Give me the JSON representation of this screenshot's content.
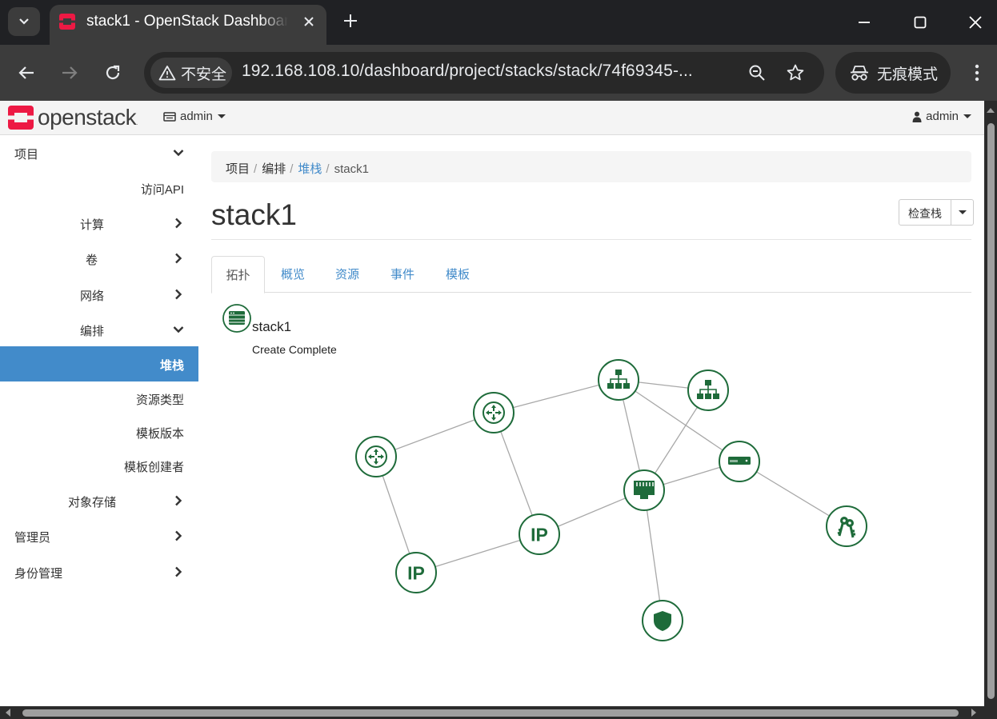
{
  "browser": {
    "tab_title": "stack1 - OpenStack Dashboard",
    "security_label": "不安全",
    "url": "192.168.108.10/dashboard/project/stacks/stack/74f69345-...",
    "incognito_label": "无痕模式"
  },
  "topnav": {
    "logo_text": "openstack",
    "logo_reg": ".",
    "project": "admin",
    "user": "admin"
  },
  "sidebar": {
    "items": [
      {
        "label": "项目",
        "chevron": "down"
      },
      {
        "label": "访问API",
        "chevron": ""
      },
      {
        "label": "计算",
        "chevron": "right"
      },
      {
        "label": "卷",
        "chevron": "right"
      },
      {
        "label": "网络",
        "chevron": "right"
      },
      {
        "label": "编排",
        "chevron": "down"
      },
      {
        "label": "堆栈",
        "chevron": "",
        "active": true
      },
      {
        "label": "资源类型",
        "chevron": ""
      },
      {
        "label": "模板版本",
        "chevron": ""
      },
      {
        "label": "模板创建者",
        "chevron": ""
      },
      {
        "label": "对象存储",
        "chevron": "right"
      },
      {
        "label": "管理员",
        "chevron": "right"
      },
      {
        "label": "身份管理",
        "chevron": "right"
      }
    ]
  },
  "breadcrumb": {
    "items": [
      "项目",
      "编排",
      "堆栈",
      "stack1"
    ]
  },
  "page": {
    "title": "stack1",
    "check_button": "检查栈"
  },
  "tabs": [
    {
      "label": "拓扑",
      "active": true
    },
    {
      "label": "概览",
      "active": false
    },
    {
      "label": "资源",
      "active": false
    },
    {
      "label": "事件",
      "active": false
    },
    {
      "label": "模板",
      "active": false
    }
  ],
  "stack_info": {
    "name": "stack1",
    "status": "Create Complete"
  },
  "topology": {
    "color": "#1e6b3a",
    "nodes": [
      {
        "id": "router1",
        "icon": "router-icon"
      },
      {
        "id": "router2",
        "icon": "router-icon"
      },
      {
        "id": "net1",
        "icon": "network-icon"
      },
      {
        "id": "net2",
        "icon": "network-icon"
      },
      {
        "id": "port",
        "icon": "port-icon"
      },
      {
        "id": "server",
        "icon": "server-icon"
      },
      {
        "id": "ip1",
        "icon": "floating-ip-icon",
        "text": "IP"
      },
      {
        "id": "ip2",
        "icon": "floating-ip-icon",
        "text": "IP"
      },
      {
        "id": "keypair",
        "icon": "keys-icon"
      },
      {
        "id": "secgroup",
        "icon": "security-group-icon"
      }
    ],
    "links": [
      [
        "router1",
        "router2"
      ],
      [
        "router1",
        "ip2"
      ],
      [
        "router2",
        "net1"
      ],
      [
        "router2",
        "ip1"
      ],
      [
        "net1",
        "net2"
      ],
      [
        "net1",
        "server"
      ],
      [
        "net1",
        "port"
      ],
      [
        "net2",
        "port"
      ],
      [
        "port",
        "server"
      ],
      [
        "port",
        "ip1"
      ],
      [
        "port",
        "secgroup"
      ],
      [
        "ip1",
        "ip2"
      ],
      [
        "server",
        "keypair"
      ]
    ]
  }
}
